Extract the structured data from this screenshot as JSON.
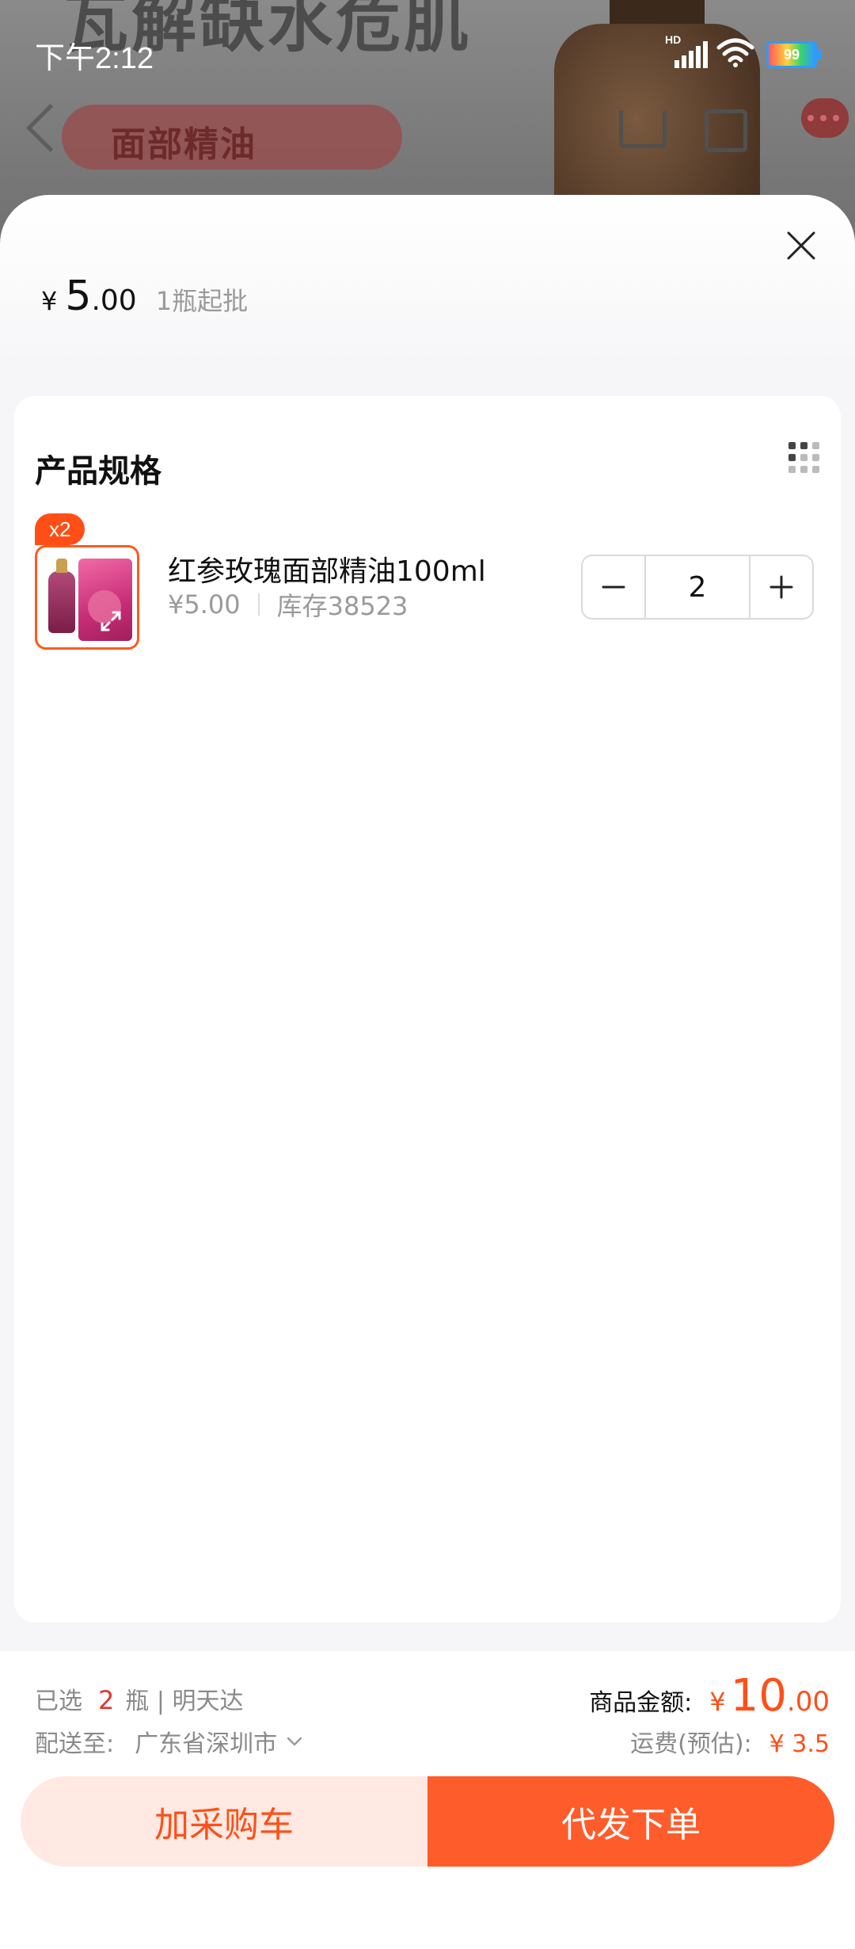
{
  "status_bar": {
    "time": "下午2:12",
    "signal_label": "HD",
    "battery_level": "99",
    "icons": [
      "signal-icon",
      "wifi-icon",
      "battery-icon"
    ]
  },
  "background_page": {
    "headline": "瓦解缺水危肌",
    "tag": "面部精油",
    "icons": [
      "back-icon",
      "cart-icon",
      "share-icon",
      "more-icon"
    ]
  },
  "sheet": {
    "price": {
      "currency": "¥",
      "integer": "5",
      "decimal": ".00"
    },
    "moq": "1瓶起批",
    "close_icon": "close-icon"
  },
  "spec": {
    "title": "产品规格",
    "view_icon": "grid-view-icon",
    "items": [
      {
        "badge": "x2",
        "name": "红参玫瑰面部精油100ml",
        "price": "¥5.00",
        "stock": "库存38523",
        "quantity": "2"
      }
    ]
  },
  "summary": {
    "selected_prefix": "已选",
    "selected_count": "2",
    "selected_suffix": "瓶 | 明天达",
    "ship_label": "配送至:",
    "ship_region": "广东省深圳市",
    "amount_label": "商品金额:",
    "amount_currency": "¥",
    "amount_integer": "10",
    "amount_decimal": ".00",
    "freight_label": "运费(预估):",
    "freight_value": "¥ 3.5"
  },
  "actions": {
    "add_to_cart": "加采购车",
    "order": "代发下单"
  },
  "colors": {
    "accent": "#ff4f17",
    "accent_button": "#ff5c2c",
    "accent_light": "#ffe9e2",
    "badge_red": "#e3342f"
  }
}
